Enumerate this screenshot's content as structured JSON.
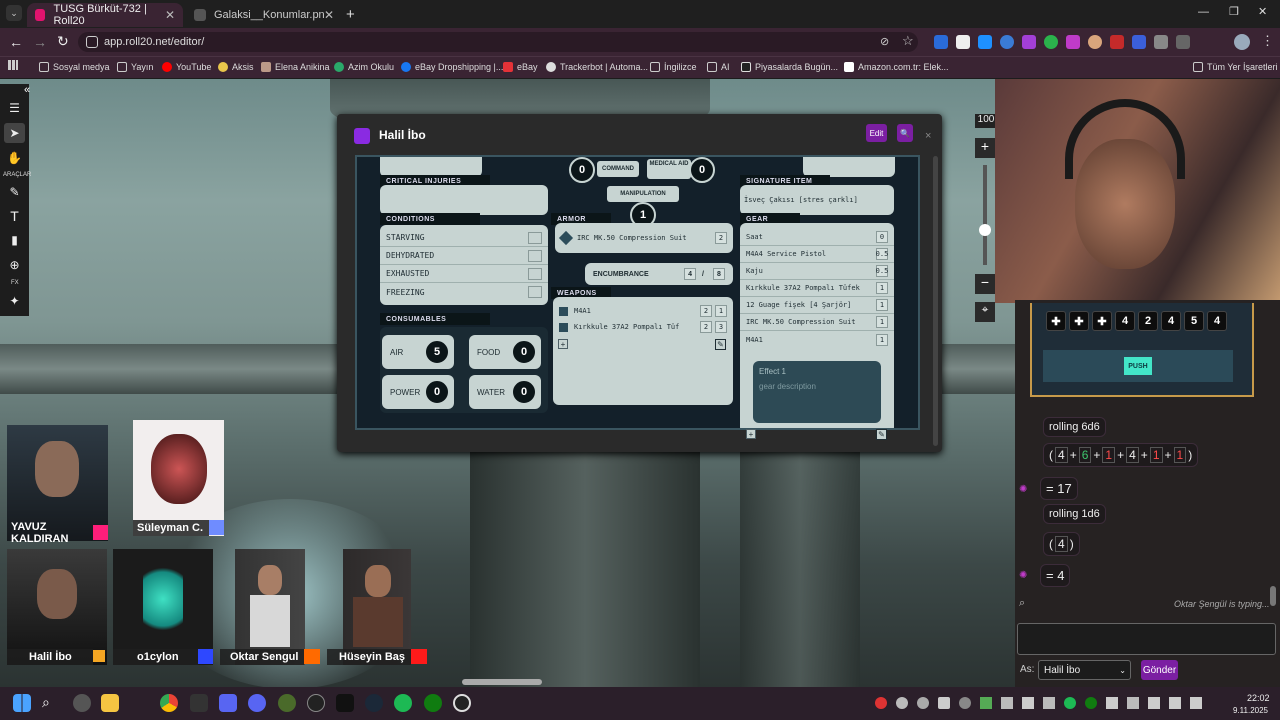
{
  "browser": {
    "tabs": [
      {
        "label": "TUSG Bürküt-732 | Roll20",
        "active": true
      },
      {
        "label": "Galaksi__Konumlar.png (2970×",
        "active": false
      }
    ],
    "url": "app.roll20.net/editor/",
    "bookmarks": [
      "Sosyal medya",
      "Yayın",
      "YouTube",
      "Aksis",
      "Elena Anikina",
      "Azim Okulu",
      "eBay Dropshipping |...",
      "eBay",
      "Trackerbot | Automa...",
      "İngilizce",
      "AI",
      "Piyasalarda Bugün...",
      "Amazon.com.tr: Elek...",
      "Tüm Yer İşaretleri"
    ]
  },
  "toolbar": {
    "tools_label": "ARAÇLAR",
    "fx_label": "FX"
  },
  "zoom": {
    "value": "100",
    "plus": "+",
    "minus": "−"
  },
  "sheet": {
    "title": "Halil İbo",
    "edit_label": "Edit",
    "critical_injuries": "CRITICAL INJURIES",
    "conditions_header": "CONDITIONS",
    "conditions": [
      "STARVING",
      "DEHYDRATED",
      "EXHAUSTED",
      "FREEZING"
    ],
    "consumables_header": "CONSUMABLES",
    "consumables": [
      {
        "label": "AIR",
        "value": "5"
      },
      {
        "label": "FOOD",
        "value": "0"
      },
      {
        "label": "POWER",
        "value": "0"
      },
      {
        "label": "WATER",
        "value": "0"
      }
    ],
    "command": {
      "label": "COMMAND",
      "value": "0"
    },
    "medical": {
      "label": "MEDICAL AID",
      "value": "0"
    },
    "manipulation": {
      "label": "MANIPULATION",
      "value": "1"
    },
    "armor_header": "ARMOR",
    "armor": {
      "name": "IRC MK.50 Compression Suit",
      "value": "2"
    },
    "encumbrance": {
      "label": "ENCUMBRANCE",
      "current": "4",
      "sep": "/",
      "max": "8"
    },
    "weapons_header": "WEAPONS",
    "weapons": [
      {
        "name": "M4A1",
        "a": "2",
        "b": "1"
      },
      {
        "name": "Kırkkule 37A2 Pompalı Tüf",
        "a": "2",
        "b": "3"
      }
    ],
    "signature_header": "SIGNATURE ITEM",
    "signature": "İsveç Çakısı [stres çarklı]",
    "gear_header": "GEAR",
    "gear": [
      {
        "name": "Saat",
        "w": "0"
      },
      {
        "name": "M4A4 Service Pistol",
        "w": "0.5"
      },
      {
        "name": "Kaju",
        "w": "0.5"
      },
      {
        "name": "Kırkkule 37A2 Pompalı Tüfek",
        "w": "1"
      },
      {
        "name": "12 Guage fişek [4 Şarjör]",
        "w": "1"
      },
      {
        "name": "IRC MK.50 Compression Suit",
        "w": "1"
      },
      {
        "name": "M4A1",
        "w": "1"
      }
    ],
    "effect_label": "Effect",
    "effect_value": "1",
    "gear_desc_placeholder": "gear description"
  },
  "players": [
    {
      "name": "YAVUZ KALDIRAN",
      "color": "#ff1e7a"
    },
    {
      "name": "Süleyman C.",
      "color": "#6f8cff"
    },
    {
      "name": "Halil İbo",
      "color": "#f5a623"
    },
    {
      "name": "o1cylon",
      "color": "#2e48ff"
    },
    {
      "name": "Oktar Sengul",
      "color": "#ff6a00"
    },
    {
      "name": "Hüseyin Baş",
      "color": "#ff1a1a"
    }
  ],
  "chat": {
    "dice": [
      "✚",
      "✚",
      "✚",
      "4",
      "2",
      "4",
      "5",
      "4"
    ],
    "push_label": "PUSH",
    "roll1": {
      "label": "rolling 6d6",
      "dice": [
        "4",
        "6",
        "1",
        "4",
        "1",
        "1"
      ],
      "ops": "+",
      "total": "17"
    },
    "roll2": {
      "label": "rolling 1d6",
      "dice": [
        "4"
      ],
      "total": "4"
    },
    "open_paren": "(",
    "close_paren": ")",
    "equals": "=",
    "typing": "Oktar Şengül is typing...",
    "as_label": "As:",
    "as_value": "Halil İbo",
    "send_label": "Gönder"
  },
  "clock": {
    "time": "22:02",
    "date": "9.11.2025"
  },
  "colors": {
    "accent": "#8a2be2",
    "die_green": "#3ec46d",
    "die_red": "#ff4b4b",
    "push": "#43e6c8"
  }
}
